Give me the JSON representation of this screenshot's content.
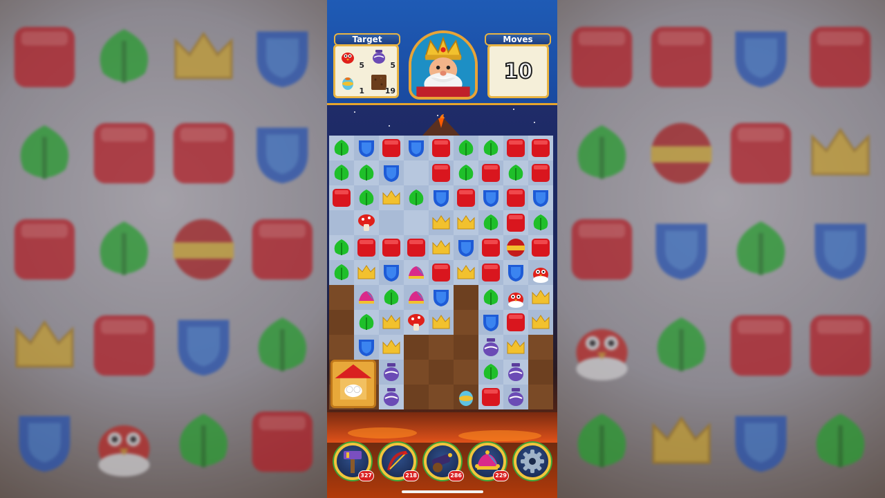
{
  "hud": {
    "target_label": "Target",
    "moves_label": "Moves",
    "moves_value": "10",
    "targets": [
      {
        "icon": "red-bird-icon",
        "count": "5"
      },
      {
        "icon": "purple-pot-icon",
        "count": "5"
      },
      {
        "icon": "egg-vase-icon",
        "count": "1"
      },
      {
        "icon": "dirt-tile-icon",
        "count": "19"
      }
    ]
  },
  "boosters": [
    {
      "icon": "hammer-booster-icon",
      "count": "327"
    },
    {
      "icon": "arrow-booster-icon",
      "count": "218"
    },
    {
      "icon": "cannon-booster-icon",
      "count": "286"
    },
    {
      "icon": "jester-hat-booster-icon",
      "count": "229"
    },
    {
      "icon": "settings-gear-icon",
      "count": ""
    }
  ],
  "colors": {
    "hud_blue": "#1f5bb5",
    "gold_border": "#e8b443",
    "red_block": "#d9161e",
    "green_leaf": "#1fbf2a",
    "blue_shield": "#1e5bd6",
    "yellow_crown": "#f2c12e"
  }
}
